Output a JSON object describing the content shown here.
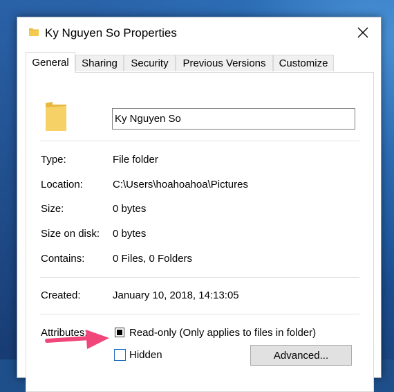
{
  "window": {
    "title": "Ky Nguyen So Properties"
  },
  "tabs": [
    {
      "label": "General"
    },
    {
      "label": "Sharing"
    },
    {
      "label": "Security"
    },
    {
      "label": "Previous Versions"
    },
    {
      "label": "Customize"
    }
  ],
  "general": {
    "folder_name": "Ky Nguyen So",
    "type_label": "Type:",
    "type_value": "File folder",
    "location_label": "Location:",
    "location_value": "C:\\Users\\hoahoahoa\\Pictures",
    "size_label": "Size:",
    "size_value": "0 bytes",
    "size_on_disk_label": "Size on disk:",
    "size_on_disk_value": "0 bytes",
    "contains_label": "Contains:",
    "contains_value": "0 Files, 0 Folders",
    "created_label": "Created:",
    "created_value": "January 10, 2018, 14:13:05",
    "attributes_label": "Attributes:",
    "readonly_label": "Read-only (Only applies to files in folder)",
    "hidden_label": "Hidden",
    "advanced_label": "Advanced..."
  },
  "colors": {
    "folder": "#f3c94f",
    "arrow": "#f0467a",
    "accent": "#1e6bb8"
  }
}
